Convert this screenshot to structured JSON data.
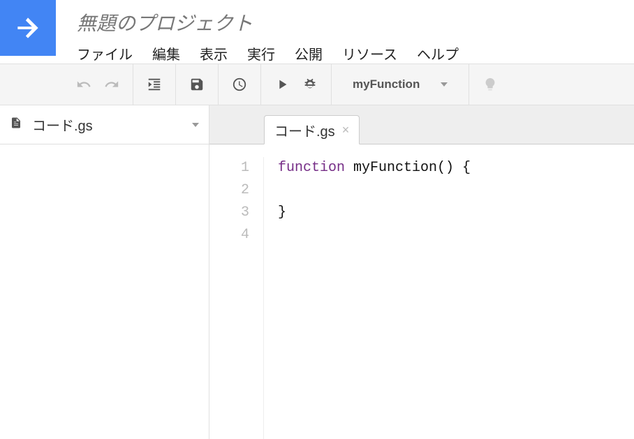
{
  "header": {
    "project_title": "無題のプロジェクト",
    "menu": [
      "ファイル",
      "編集",
      "表示",
      "実行",
      "公開",
      "リソース",
      "ヘルプ"
    ]
  },
  "toolbar": {
    "function_selected": "myFunction"
  },
  "sidebar": {
    "files": [
      {
        "name": "コード.gs"
      }
    ]
  },
  "editor": {
    "tab_name": "コード.gs",
    "lines": [
      {
        "n": "1",
        "tokens": [
          {
            "t": "kw",
            "v": "function"
          },
          {
            "t": "plain",
            "v": " myFunction() {"
          }
        ]
      },
      {
        "n": "2",
        "tokens": [
          {
            "t": "plain",
            "v": "  "
          }
        ]
      },
      {
        "n": "3",
        "tokens": [
          {
            "t": "plain",
            "v": "}"
          }
        ]
      },
      {
        "n": "4",
        "tokens": []
      }
    ]
  }
}
